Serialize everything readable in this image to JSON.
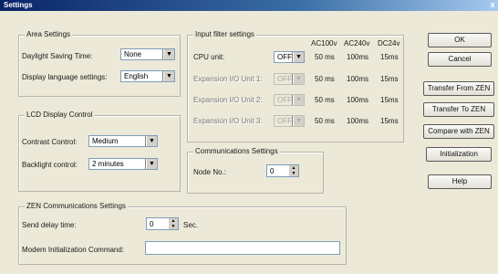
{
  "window": {
    "title": "Settings",
    "close_glyph": "x"
  },
  "area_settings": {
    "legend": "Area Settings",
    "daylight_label": "Daylight Saving Time:",
    "daylight_value": "None",
    "language_label": "Display language settings:",
    "language_value": "English"
  },
  "lcd": {
    "legend": "LCD Display Control",
    "contrast_label": "Contrast Control:",
    "contrast_value": "Medium",
    "backlight_label": "Backlight control:",
    "backlight_value": "2 minutes"
  },
  "input_filter": {
    "legend": "Input filter settings",
    "headers": [
      "AC100v",
      "AC240v",
      "DC24v"
    ],
    "rows": [
      {
        "label": "CPU unit:",
        "value": "OFF",
        "enabled": true,
        "times": [
          "50 ms",
          "100ms",
          "15ms"
        ]
      },
      {
        "label": "Expansion I/O Unit 1:",
        "value": "OFF",
        "enabled": false,
        "times": [
          "50 ms",
          "100ms",
          "15ms"
        ]
      },
      {
        "label": "Expansion I/O Unit 2:",
        "value": "OFF",
        "enabled": false,
        "times": [
          "50 ms",
          "100ms",
          "15ms"
        ]
      },
      {
        "label": "Expansion I/O Unit 3:",
        "value": "OFF",
        "enabled": false,
        "times": [
          "50 ms",
          "100ms",
          "15ms"
        ]
      }
    ]
  },
  "comms": {
    "legend": "Communications Settings",
    "node_label": "Node No.:",
    "node_value": "0"
  },
  "zen_comms": {
    "legend": "ZEN Communications Settings",
    "delay_label": "Send delay time:",
    "delay_value": "0",
    "delay_unit": "Sec.",
    "modem_label": "Modem Initialization Command:",
    "modem_value": ""
  },
  "buttons": {
    "ok": "OK",
    "cancel": "Cancel",
    "transfer_from": "Transfer From ZEN",
    "transfer_to": "Transfer To ZEN",
    "compare": "Compare with ZEN",
    "initialization": "Initialization",
    "help": "Help"
  }
}
